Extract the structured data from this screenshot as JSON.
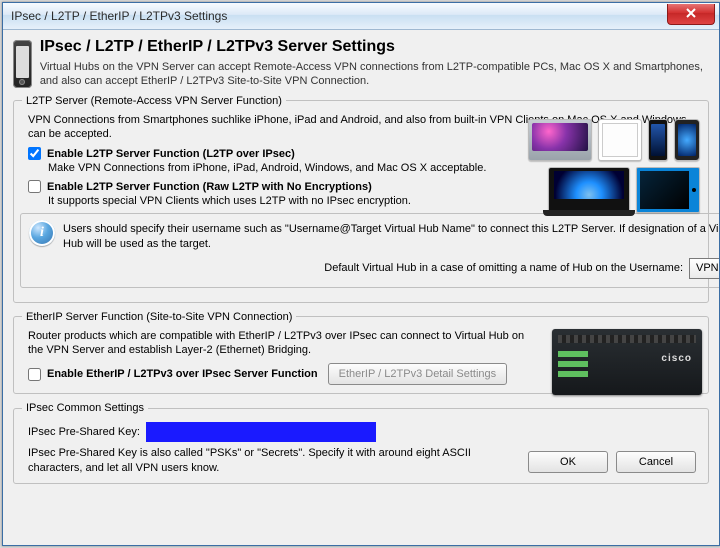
{
  "window": {
    "title": "IPsec / L2TP / EtherIP / L2TPv3 Settings"
  },
  "header": {
    "title": "IPsec / L2TP / EtherIP / L2TPv3 Server Settings",
    "subtitle": "Virtual Hubs on the VPN Server can accept Remote-Access VPN connections from L2TP-compatible PCs, Mac OS X and Smartphones, and also can accept EtherIP / L2TPv3 Site-to-Site VPN Connection."
  },
  "l2tp": {
    "legend": "L2TP Server (Remote-Access VPN Server Function)",
    "desc": "VPN Connections from Smartphones suchlike iPhone, iPad and Android, and also from built-in VPN Clients on Mac OS X and Windows can be accepted.",
    "opt_ipsec": {
      "label": "Enable L2TP Server Function (L2TP over IPsec)",
      "checked": true,
      "desc": "Make VPN Connections from iPhone, iPad, Android, Windows, and Mac OS X acceptable."
    },
    "opt_raw": {
      "label": "Enable L2TP Server Function (Raw L2TP with No Encryptions)",
      "checked": false,
      "desc": "It supports special VPN Clients which uses L2TP with no IPsec encryption."
    },
    "info": "Users should specify their username such as \"Username@Target Virtual Hub Name\" to connect this L2TP Server. If designation of a Virtual Hub is omitted, the below Hub will be used as the target.",
    "hub_label": "Default Virtual Hub in a case of omitting a name of Hub on the Username:",
    "hub_value": "VPN"
  },
  "etherip": {
    "legend": "EtherIP Server Function (Site-to-Site VPN Connection)",
    "desc": "Router products which are compatible with EtherIP / L2TPv3 over IPsec can connect to Virtual Hub on the VPN Server and establish Layer-2 (Ethernet) Bridging.",
    "opt": {
      "label": "Enable EtherIP / L2TPv3 over IPsec Server Function",
      "checked": false
    },
    "detail_btn": "EtherIP / L2TPv3 Detail Settings",
    "router_brand": "cisco"
  },
  "ipsec": {
    "legend": "IPsec Common Settings",
    "psk_label": "IPsec Pre-Shared Key:",
    "psk_value": "",
    "psk_note": "IPsec Pre-Shared Key is also called \"PSKs\" or \"Secrets\". Specify it with around eight ASCII characters, and let all VPN users know."
  },
  "footer": {
    "ok": "OK",
    "cancel": "Cancel"
  }
}
